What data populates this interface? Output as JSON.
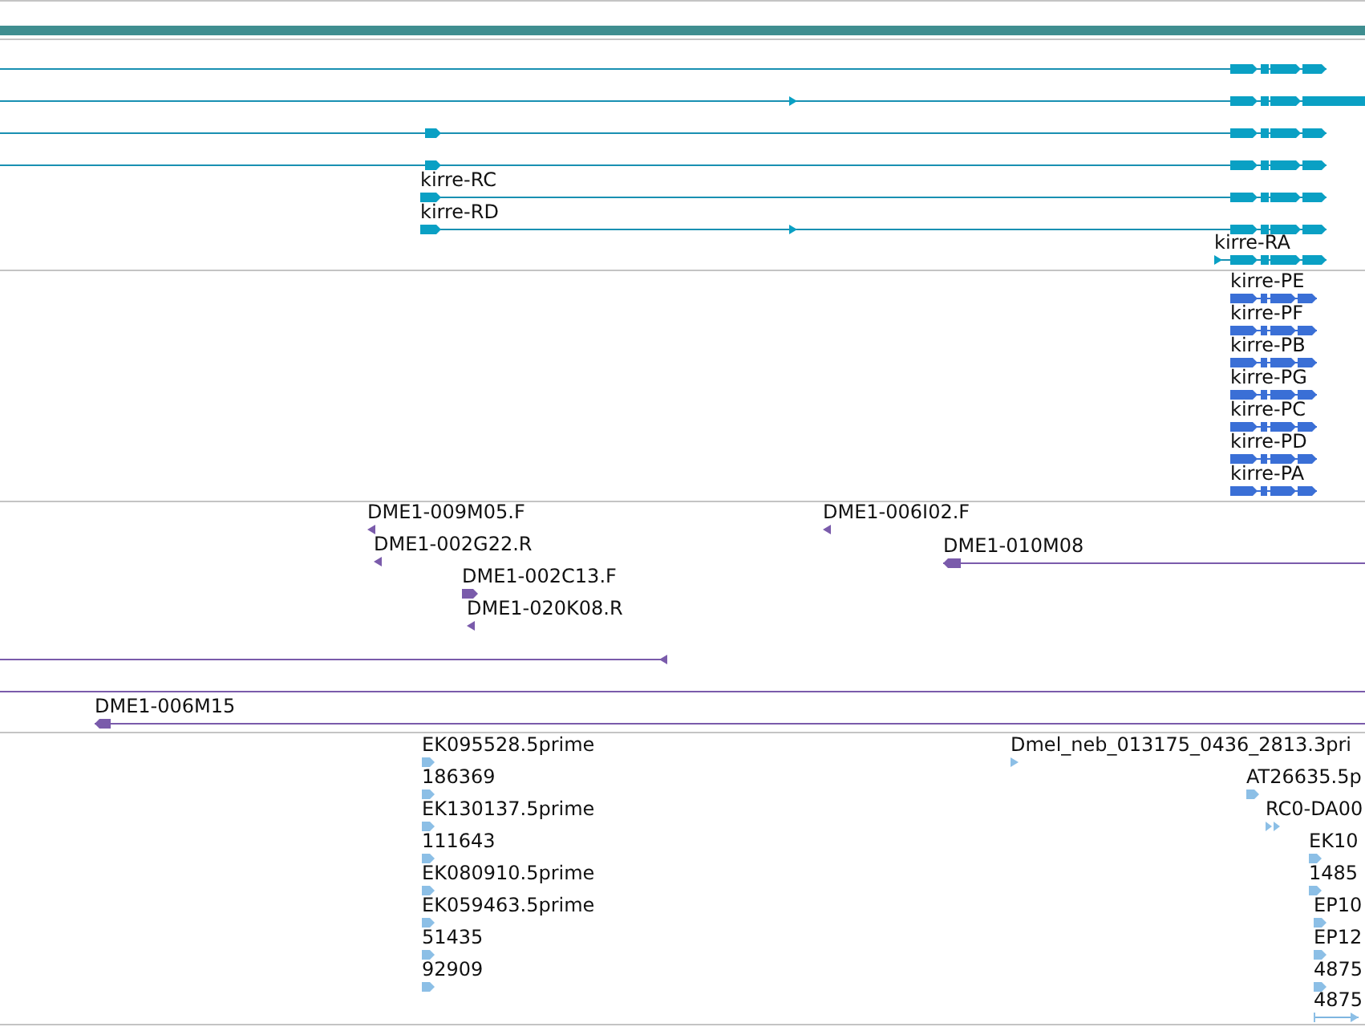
{
  "tracks": [
    {
      "kind": "transcripts",
      "features": [
        {
          "kind": "model",
          "reverse": false
        },
        {
          "kind": "model",
          "reverse": false
        },
        {
          "kind": "model",
          "reverse": false
        },
        {
          "kind": "model",
          "reverse": false
        },
        {
          "kind": "model",
          "label": "kirre-RC",
          "reverse": false
        },
        {
          "kind": "model",
          "label": "kirre-RD",
          "reverse": false
        },
        {
          "kind": "model",
          "label": "kirre-RA",
          "reverse": false
        }
      ]
    },
    {
      "kind": "proteins",
      "features": [
        {
          "kind": "model",
          "label": "kirre-PE",
          "reverse": false
        },
        {
          "kind": "model",
          "label": "kirre-PF",
          "reverse": false
        },
        {
          "kind": "model",
          "label": "kirre-PB",
          "reverse": false
        },
        {
          "kind": "model",
          "label": "kirre-PG",
          "reverse": false
        },
        {
          "kind": "model",
          "label": "kirre-PC",
          "reverse": false
        },
        {
          "kind": "model",
          "label": "kirre-PD",
          "reverse": false
        },
        {
          "kind": "model",
          "label": "kirre-PA",
          "reverse": false
        }
      ]
    },
    {
      "kind": "clones",
      "features": [
        {
          "kind": "marker",
          "label": "DME1-009M05.F",
          "reverse": true
        },
        {
          "kind": "marker",
          "label": "DME1-006I02.F",
          "reverse": true
        },
        {
          "kind": "marker",
          "label": "DME1-002G22.R",
          "reverse": true
        },
        {
          "kind": "span",
          "label": "DME1-010M08",
          "reverse": true
        },
        {
          "kind": "marker",
          "label": "DME1-002C13.F",
          "reverse": false
        },
        {
          "kind": "marker",
          "label": "DME1-020K08.R",
          "reverse": true
        },
        {
          "kind": "span",
          "reverse": true
        },
        {
          "kind": "span"
        },
        {
          "kind": "span",
          "label": "DME1-006M15",
          "reverse": true
        }
      ]
    },
    {
      "kind": "ests",
      "features": [
        {
          "kind": "marker",
          "label": "EK095528.5prime",
          "reverse": false
        },
        {
          "kind": "marker",
          "label": "Dmel_neb_013175_0436_2813.3pri",
          "reverse": false
        },
        {
          "kind": "marker",
          "label": "186369",
          "reverse": false
        },
        {
          "kind": "marker",
          "label": "AT26635.5p",
          "reverse": false
        },
        {
          "kind": "marker",
          "label": "EK130137.5prime",
          "reverse": false
        },
        {
          "kind": "marker",
          "label": "RC0-DA00",
          "reverse": false
        },
        {
          "kind": "marker",
          "label": "111643",
          "reverse": false
        },
        {
          "kind": "marker",
          "label": "EK10",
          "reverse": false
        },
        {
          "kind": "marker",
          "label": "EK080910.5prime",
          "reverse": false
        },
        {
          "kind": "marker",
          "label": "1485",
          "reverse": false
        },
        {
          "kind": "marker",
          "label": "EK059463.5prime",
          "reverse": false
        },
        {
          "kind": "marker",
          "label": "EP10",
          "reverse": false
        },
        {
          "kind": "marker",
          "label": "51435",
          "reverse": false
        },
        {
          "kind": "marker",
          "label": "EP12",
          "reverse": false
        },
        {
          "kind": "marker",
          "label": "92909",
          "reverse": false
        },
        {
          "kind": "marker",
          "label": "4875",
          "reverse": false
        },
        {
          "kind": "span",
          "label": "4875",
          "reverse": false
        }
      ]
    }
  ]
}
